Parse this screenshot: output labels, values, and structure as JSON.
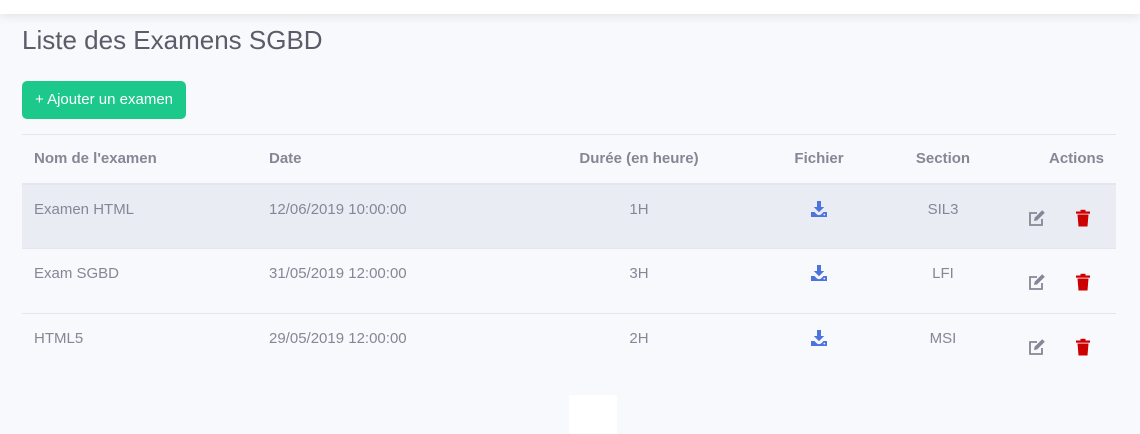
{
  "page": {
    "title": "Liste des Examens SGBD",
    "add_button_label": "+ Ajouter un examen"
  },
  "table": {
    "columns": [
      "Nom de l'examen",
      "Date",
      "Durée (en heure)",
      "Fichier",
      "Section",
      "Actions"
    ],
    "rows": [
      {
        "name": "Examen HTML",
        "date": "12/06/2019 10:00:00",
        "duration": "1H",
        "section": "SIL3"
      },
      {
        "name": "Exam SGBD",
        "date": "31/05/2019 12:00:00",
        "duration": "3H",
        "section": "LFI"
      },
      {
        "name": "HTML5",
        "date": "29/05/2019 12:00:00",
        "duration": "2H",
        "section": "MSI"
      }
    ]
  },
  "icons": {
    "file": "download-icon",
    "edit": "edit-icon",
    "delete": "trash-icon"
  },
  "colors": {
    "accent_green": "#1cc88a",
    "download_blue": "#4e73df",
    "delete_red": "#cc0000",
    "edit_gray": "#858796"
  }
}
